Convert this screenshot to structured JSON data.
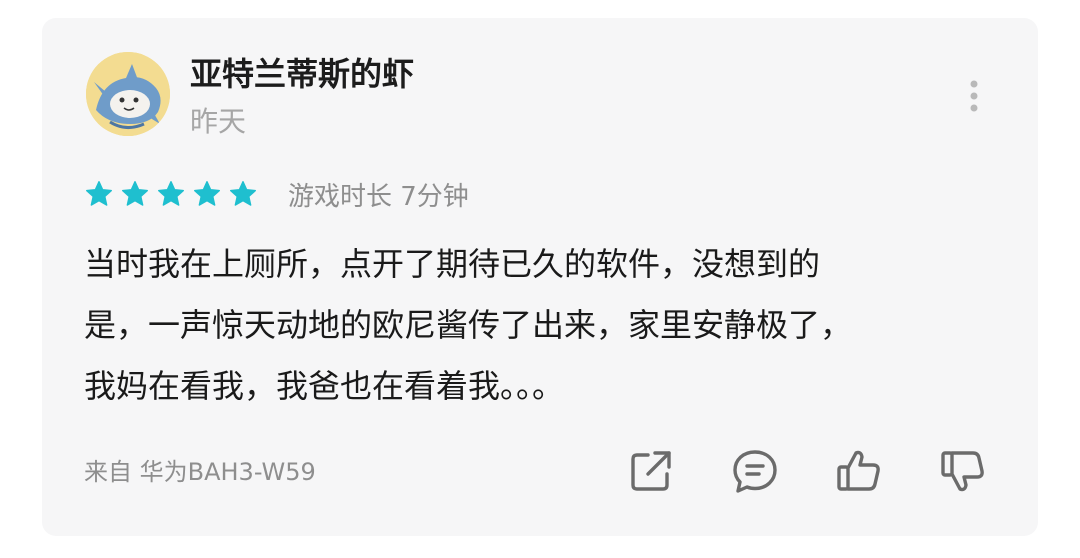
{
  "review": {
    "username": "亚特兰蒂斯的虾",
    "date": "昨天",
    "rating": 5,
    "rating_max": 5,
    "star_color": "#1fbfcf",
    "playtime": "游戏时长 7分钟",
    "content_lines": [
      "当时我在上厕所，点开了期待已久的软件，没想到的",
      "是，一声惊天动地的欧尼酱传了出来，家里安静极了，",
      "我妈在看我，我爸也在看着我。。。"
    ],
    "device": "来自 华为BAH3-W59"
  },
  "actions": [
    {
      "name": "share-icon"
    },
    {
      "name": "comment-icon"
    },
    {
      "name": "thumbs-up-icon"
    },
    {
      "name": "thumbs-down-icon"
    }
  ],
  "icons": {
    "avatar": "shark-character-avatar",
    "more": "more-vertical-icon"
  }
}
